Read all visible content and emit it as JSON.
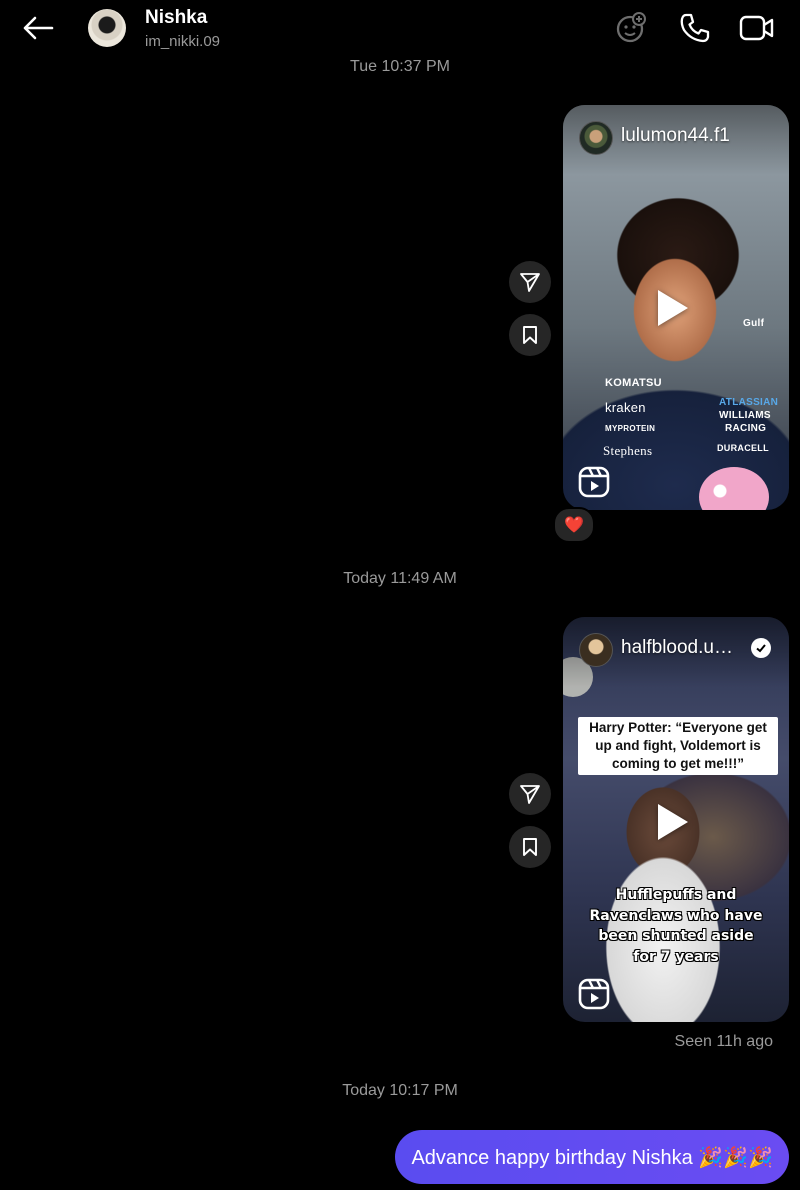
{
  "header": {
    "name": "Nishka",
    "username": "im_nikki.09"
  },
  "timestamps": {
    "first": "Tue 10:37 PM",
    "second": "Today 11:49 AM",
    "third": "Today 10:17 PM"
  },
  "messages": [
    {
      "type": "reel",
      "author": "lulumon44.f1",
      "verified": false,
      "reaction": "❤️",
      "overlay_texts": [
        "KOMATSU",
        "kraken",
        "MYPROTEIN",
        "Stephens",
        "ATLASSIAN",
        "WILLIAMS",
        "RACING",
        "DURACELL",
        "Gulf"
      ]
    },
    {
      "type": "reel",
      "author": "halfblood.u…",
      "verified": true,
      "caption_top": "Harry Potter: “Everyone get up and fight, Voldemort is coming to get me!!!”",
      "caption_bottom": "Hufflepuffs and Ravenclaws who have been shunted aside for 7 years",
      "status": "Seen 11h ago"
    },
    {
      "type": "text",
      "text": "Advance happy birthday Nishka 🎉🎉🎉"
    }
  ],
  "icons": {
    "back": "arrow-left-icon",
    "effects": "sticker-effects-icon",
    "call": "phone-icon",
    "video": "video-camera-icon",
    "share": "send-icon",
    "save": "bookmark-icon",
    "reel": "reels-icon",
    "play": "play-icon"
  },
  "colors": {
    "background": "#000000",
    "bubble": "#5a4cf0",
    "muted_text": "#9a9a9a",
    "action_button": "#262626"
  }
}
